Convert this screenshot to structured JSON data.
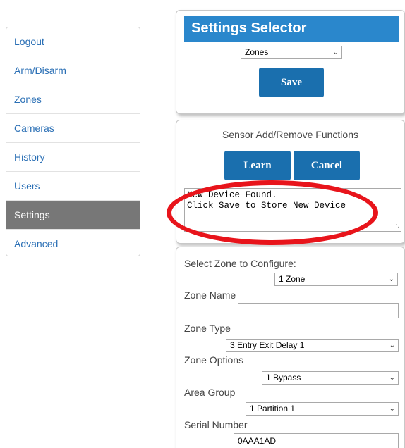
{
  "sidebar": {
    "items": [
      {
        "label": "Logout"
      },
      {
        "label": "Arm/Disarm"
      },
      {
        "label": "Zones"
      },
      {
        "label": "Cameras"
      },
      {
        "label": "History"
      },
      {
        "label": "Users"
      },
      {
        "label": "Settings",
        "active": true
      },
      {
        "label": "Advanced"
      }
    ]
  },
  "settings_selector": {
    "title": "Settings Selector",
    "selected": "Zones",
    "save_label": "Save"
  },
  "sensor": {
    "title": "Sensor Add/Remove Functions",
    "learn_label": "Learn",
    "cancel_label": "Cancel",
    "message_line1": "New Device Found.",
    "message_line2": "Click Save to Store New Device"
  },
  "zone_config": {
    "select_label": "Select Zone to Configure:",
    "zone_selected": "1 Zone",
    "name_label": "Zone Name",
    "name_value": "",
    "type_label": "Zone Type",
    "type_selected": "3 Entry Exit Delay 1",
    "options_label": "Zone Options",
    "options_selected": "1 Bypass",
    "area_label": "Area Group",
    "area_selected": "1 Partition 1",
    "serial_label": "Serial Number",
    "serial_value": "0AAA1AD"
  },
  "colors": {
    "header_blue": "#2a87cc",
    "button_blue": "#1a6fae",
    "link_blue": "#2a6fb5",
    "active_gray": "#777777",
    "highlight_red": "#e8141b"
  }
}
